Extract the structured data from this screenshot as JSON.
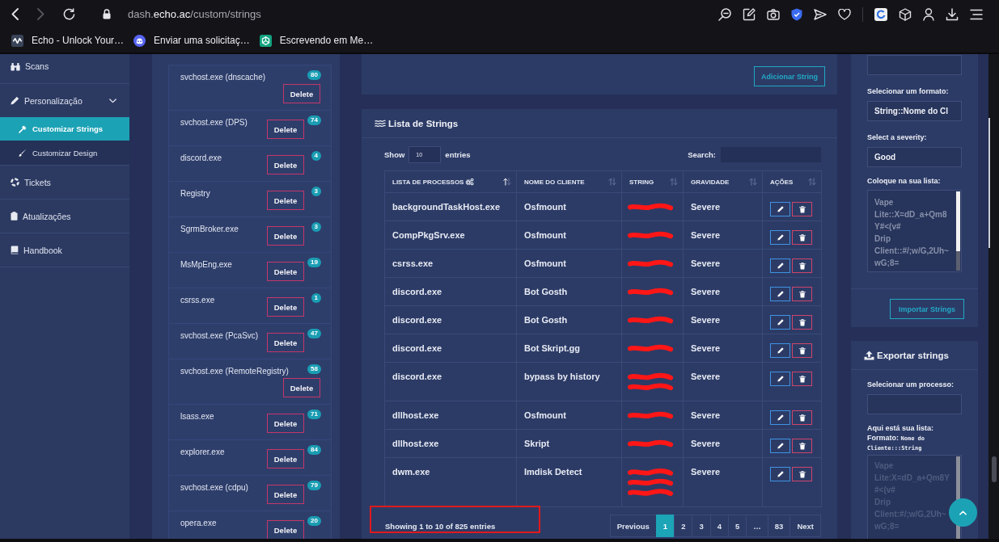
{
  "browser": {
    "nav": [
      {
        "kind": "back",
        "disabled": false
      },
      {
        "kind": "forward",
        "disabled": true
      },
      {
        "kind": "reload",
        "disabled": false
      }
    ],
    "url": "dash.**echo.ac**/custom/strings",
    "bookmarks": [
      {
        "label": "Echo - Unlock Your…"
      },
      {
        "label": "Enviar uma solicitaç…"
      },
      {
        "label": "Escrevendo em Me…"
      }
    ]
  },
  "sidebar": {
    "items": [
      {
        "label": "Scans",
        "kind": "link",
        "selected": false
      },
      {
        "label": "Personalização",
        "kind": "group",
        "selected": false,
        "expanded": true,
        "children": [
          {
            "label": "Customizar Strings",
            "selected": true
          },
          {
            "label": "Customizar Design",
            "selected": false
          }
        ]
      },
      {
        "label": "Tickets",
        "kind": "link",
        "selected": false
      },
      {
        "label": "Atualizações",
        "kind": "link",
        "selected": false
      },
      {
        "label": "Handbook",
        "kind": "link",
        "selected": false
      }
    ]
  },
  "processes": [
    {
      "name": "svchost.exe (dnscache)",
      "count": "80",
      "action": "Delete"
    },
    {
      "name": "svchost.exe (DPS)",
      "count": "74",
      "action": "Delete"
    },
    {
      "name": "discord.exe",
      "count": "4",
      "action": "Delete"
    },
    {
      "name": "Registry",
      "count": "3",
      "action": "Delete"
    },
    {
      "name": "SgrmBroker.exe",
      "count": "3",
      "action": "Delete"
    },
    {
      "name": "MsMpEng.exe",
      "count": "19",
      "action": "Delete"
    },
    {
      "name": "csrss.exe",
      "count": "1",
      "action": "Delete"
    },
    {
      "name": "svchost.exe (PcaSvc)",
      "count": "47",
      "action": "Delete"
    },
    {
      "name": "svchost.exe (RemoteRegistry)",
      "count": "58",
      "action": "Delete"
    },
    {
      "name": "lsass.exe",
      "count": "71",
      "action": "Delete"
    },
    {
      "name": "explorer.exe",
      "count": "84",
      "action": "Delete"
    },
    {
      "name": "svchost.exe (cdpu)",
      "count": "79",
      "action": "Delete"
    },
    {
      "name": "opera.exe",
      "count": "20",
      "action": "Delete"
    }
  ],
  "add_button": "Adicionar String",
  "table": {
    "title": "Lista de Strings",
    "length_label": "Show",
    "length_value": "10",
    "length_suffix": "entries",
    "search_label": "Search:",
    "columns": [
      {
        "label": "LISTA DE PROCESSOS",
        "sorted": true
      },
      {
        "label": "NOME DO CLIENTE",
        "sorted": false
      },
      {
        "label": "STRING",
        "sorted": false
      },
      {
        "label": "GRAVIDADE",
        "sorted": false
      },
      {
        "label": "AÇÕES",
        "sorted": false
      }
    ],
    "rows": [
      {
        "process": "backgroundTaskHost.exe",
        "client": "Osfmount",
        "string_lines": [
          {
            "redacted": true
          }
        ],
        "severity": "Severe"
      },
      {
        "process": "CompPkgSrv.exe",
        "client": "Osfmount",
        "string_lines": [
          {
            "redacted": true
          }
        ],
        "severity": "Severe"
      },
      {
        "process": "csrss.exe",
        "client": "Osfmount",
        "string_lines": [
          {
            "redacted": true
          }
        ],
        "severity": "Severe"
      },
      {
        "process": "discord.exe",
        "client": "Bot Gosth",
        "string_lines": [
          {
            "redacted": true
          }
        ],
        "severity": "Severe"
      },
      {
        "process": "discord.exe",
        "client": "Bot Gosth",
        "string_lines": [
          {
            "redacted": true
          }
        ],
        "severity": "Severe"
      },
      {
        "process": "discord.exe",
        "client": "Bot Skript.gg",
        "string_lines": [
          {
            "redacted": true
          }
        ],
        "severity": "Severe"
      },
      {
        "process": "discord.exe",
        "client": "bypass by history",
        "string_lines": [
          {
            "redacted": true
          },
          {
            "redacted": true
          }
        ],
        "severity": "Severe"
      },
      {
        "process": "dllhost.exe",
        "client": "Osfmount",
        "string_lines": [
          {
            "redacted": true
          }
        ],
        "severity": "Severe"
      },
      {
        "process": "dllhost.exe",
        "client": "Skript",
        "string_lines": [
          {
            "redacted": true
          }
        ],
        "severity": "Severe"
      },
      {
        "process": "dwm.exe",
        "client": "Imdisk Detect",
        "string_lines": [
          {
            "redacted": true
          },
          {
            "redacted": true
          },
          {
            "redacted": true
          }
        ],
        "severity": "Severe"
      }
    ],
    "footer": {
      "info": "Showing 1 to 10 of 825 entries",
      "highlighted": true
    },
    "pages": [
      {
        "label": "Previous",
        "selected": false
      },
      {
        "label": "1",
        "selected": true
      },
      {
        "label": "2",
        "selected": false
      },
      {
        "label": "3",
        "selected": false
      },
      {
        "label": "4",
        "selected": false
      },
      {
        "label": "5",
        "selected": false
      },
      {
        "label": "…",
        "selected": false
      },
      {
        "label": "83",
        "selected": false
      },
      {
        "label": "Next",
        "selected": false
      }
    ]
  },
  "import": {
    "fields": [
      {
        "kind": "input"
      },
      {
        "kind": "select",
        "label": "Selecionar um formato:",
        "value": "String::Nome do Cl"
      },
      {
        "kind": "select",
        "label": "Select a severity:",
        "value": "Good"
      },
      {
        "kind": "textarea",
        "label": "Coloque na sua lista:",
        "placeholder": "Vape Lite::X=dD_a+Qm8Y#<(v#\nDrip Client::#/;w/G,2Uh~wG;8=",
        "readonly": false
      }
    ],
    "button": "Importar Strings"
  },
  "export": {
    "title": "Exportar strings",
    "fields": [
      {
        "kind": "input",
        "label": "Selecionar um processo:"
      },
      {
        "kind": "textarea",
        "label": "Aqui está sua lista:",
        "format_label": "Formato:",
        "format_value": "Nome do Cliente:::String",
        "placeholder": "Vape Lite:X=dD_a+Qm8Y#<(v#\nDrip Client:#/;w/G,2Uh~wG;8=",
        "readonly": true
      }
    ]
  }
}
